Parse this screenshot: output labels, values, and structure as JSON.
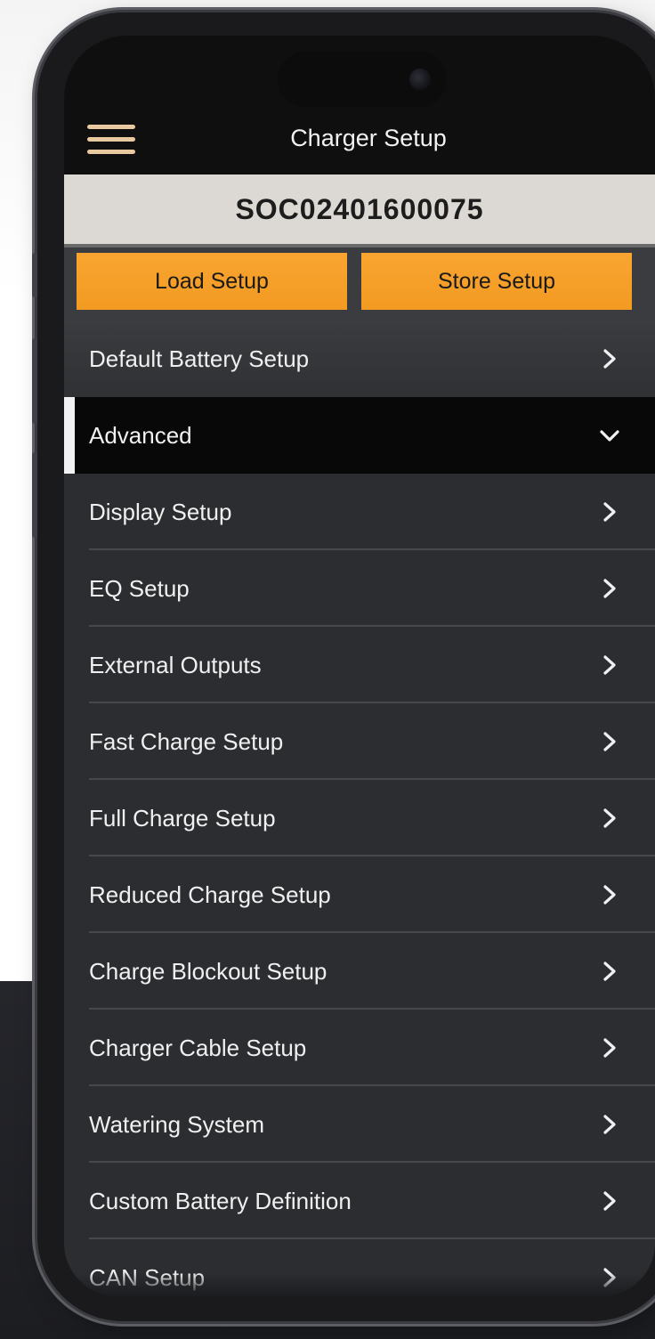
{
  "app": {
    "title": "Charger Setup",
    "serial": "SOC02401600075"
  },
  "actions": {
    "load_label": "Load Setup",
    "store_label": "Store Setup"
  },
  "menu": {
    "items": [
      {
        "label": "Default Battery Setup",
        "icon": "chevron-right-icon"
      },
      {
        "label": "Advanced",
        "icon": "chevron-down-icon",
        "expanded": true
      },
      {
        "label": "Display Setup",
        "icon": "chevron-right-icon"
      },
      {
        "label": "EQ Setup",
        "icon": "chevron-right-icon"
      },
      {
        "label": "External Outputs",
        "icon": "chevron-right-icon"
      },
      {
        "label": "Fast Charge Setup",
        "icon": "chevron-right-icon"
      },
      {
        "label": "Full Charge Setup",
        "icon": "chevron-right-icon"
      },
      {
        "label": "Reduced Charge Setup",
        "icon": "chevron-right-icon"
      },
      {
        "label": "Charge Blockout Setup",
        "icon": "chevron-right-icon"
      },
      {
        "label": "Charger Cable Setup",
        "icon": "chevron-right-icon"
      },
      {
        "label": "Watering System",
        "icon": "chevron-right-icon"
      },
      {
        "label": "Custom Battery Definition",
        "icon": "chevron-right-icon"
      },
      {
        "label": "CAN Setup",
        "icon": "chevron-right-icon"
      }
    ]
  },
  "colors": {
    "accent": "#f39a22",
    "header": "#0f0f10",
    "menu_bg": "#2b2d30",
    "serial_bg": "#dcd9d4"
  }
}
